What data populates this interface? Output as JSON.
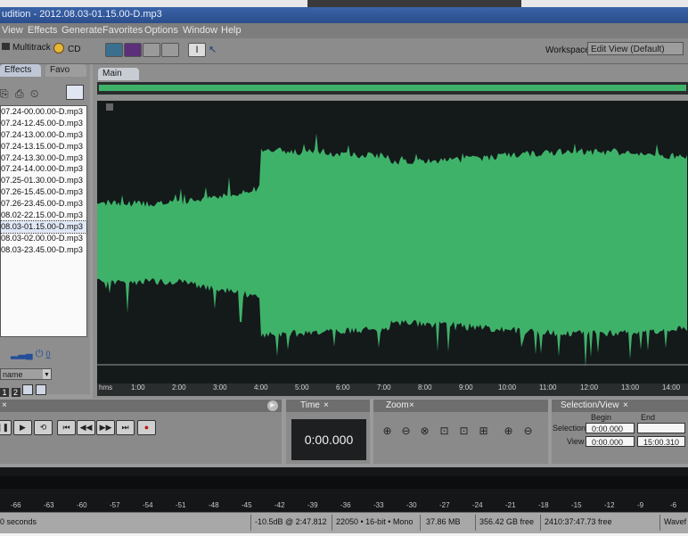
{
  "window": {
    "title": "udition - 2012.08.03-01.15.00-D.mp3"
  },
  "menu": {
    "items": [
      "View",
      "Effects",
      "Generate",
      "Favorites",
      "Options",
      "Window",
      "Help"
    ]
  },
  "toolbar": {
    "multitrack_label": "Multitrack",
    "cd_label": "CD",
    "workspace_label": "Workspace:",
    "workspace_value": "Edit View (Default)"
  },
  "left_panel": {
    "tabs": [
      "Effects",
      "Favo"
    ],
    "files": [
      "07.24-00.00.00-D.mp3",
      "07.24-12.45.00-D.mp3",
      "07.24-13.00.00-D.mp3",
      "07.24-13.15.00-D.mp3",
      "07.24-13.30.00-D.mp3",
      "07.24-14.00.00-D.mp3",
      "07.25-01.30.00-D.mp3",
      "07.26-15.45.00-D.mp3",
      "07.26-23.45.00-D.mp3",
      "08.02-22.15.00-D.mp3",
      "08.03-01.15.00-D.mp3",
      "08.03-02.00.00-D.mp3",
      "08.03-23.45.00-D.mp3"
    ],
    "selected_index": 10,
    "volume_value": "0",
    "sort_label": "name"
  },
  "main_panel": {
    "tab": "Main",
    "time_units": "hms",
    "ticks": [
      "1:00",
      "2:00",
      "3:00",
      "4:00",
      "5:00",
      "6:00",
      "7:00",
      "8:00",
      "9:00",
      "10:00",
      "11:00",
      "12:00",
      "13:00",
      "14:00"
    ],
    "wave_color": "#3fb26a"
  },
  "time_panel": {
    "title": "Time",
    "value": "0:00.000"
  },
  "zoom_panel": {
    "title": "Zoom"
  },
  "selection_panel": {
    "title": "Selection/View",
    "begin_label": "Begin",
    "end_label": "End",
    "selection_label": "Selection",
    "view_label": "View",
    "selection_begin": "0:00.000",
    "selection_end": "",
    "view_begin": "0:00.000",
    "view_end": "15:00.310"
  },
  "level_meter": {
    "ticks": [
      "-66",
      "-63",
      "-60",
      "-57",
      "-54",
      "-51",
      "-48",
      "-45",
      "-42",
      "-39",
      "-36",
      "-33",
      "-30",
      "-27",
      "-24",
      "-21",
      "-18",
      "-15",
      "-12",
      "-9",
      "-6"
    ]
  },
  "status": {
    "seconds": "0 seconds",
    "level": "-10.5dB @ 2:47.812",
    "format": "22050 • 16-bit • Mono",
    "size": "37.86 MB",
    "disk": "356.42 GB free",
    "time_free": "2410:37:47.73 free",
    "wave": "Wavef"
  }
}
